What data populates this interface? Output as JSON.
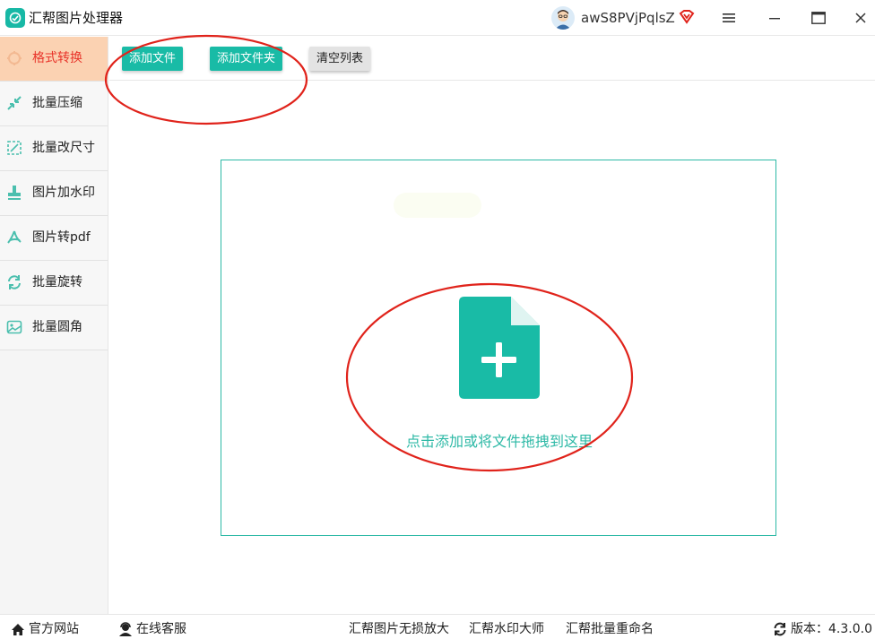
{
  "app": {
    "title": "汇帮图片处理器",
    "username": "awS8PVjPqlsZ",
    "accent_color": "#19bba6",
    "active_color": "#e8342a",
    "annotation_color": "#e0231b"
  },
  "sidebar": {
    "items": [
      {
        "label": "格式转换",
        "icon": "format-convert-icon",
        "active": true
      },
      {
        "label": "批量压缩",
        "icon": "compress-icon",
        "active": false
      },
      {
        "label": "批量改尺寸",
        "icon": "resize-icon",
        "active": false
      },
      {
        "label": "图片加水印",
        "icon": "watermark-icon",
        "active": false
      },
      {
        "label": "图片转pdf",
        "icon": "pdf-icon",
        "active": false
      },
      {
        "label": "批量旋转",
        "icon": "rotate-icon",
        "active": false
      },
      {
        "label": "批量圆角",
        "icon": "round-corner-icon",
        "active": false
      }
    ]
  },
  "toolbar": {
    "add_file_label": "添加文件",
    "add_folder_label": "添加文件夹",
    "clear_list_label": "清空列表"
  },
  "dropzone": {
    "hint": "点击添加或将文件拖拽到这里",
    "icon": "add-file-icon"
  },
  "footer": {
    "website_label": "官方网站",
    "support_label": "在线客服",
    "link1_label": "汇帮图片无损放大",
    "link2_label": "汇帮水印大师",
    "link3_label": "汇帮批量重命名",
    "version_label": "版本：4.3.0.0"
  }
}
